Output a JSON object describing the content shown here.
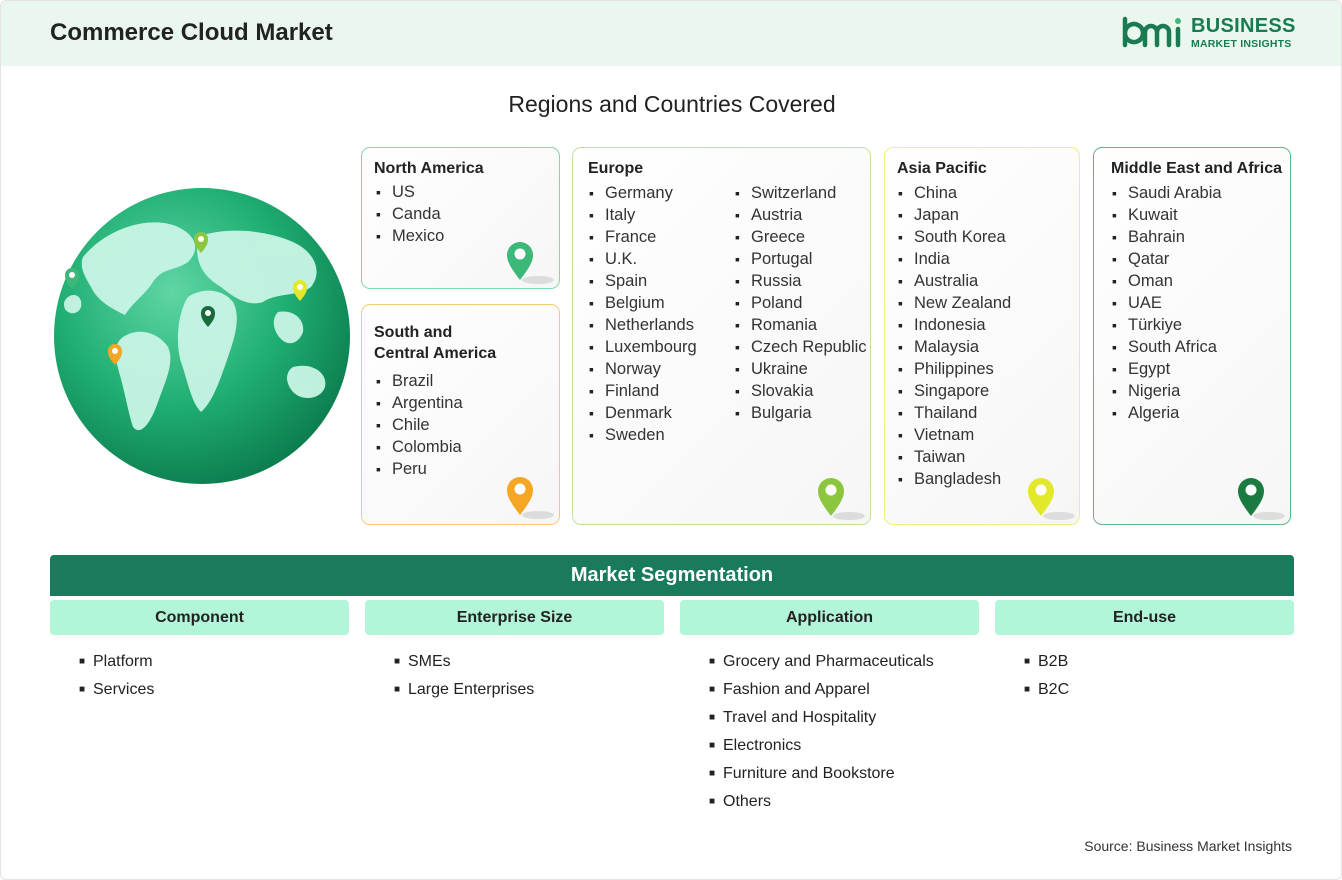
{
  "header": {
    "title": "Commerce Cloud Market"
  },
  "logo": {
    "mark_text": "bmi",
    "line1": "BUSINESS",
    "line2": "MARKET INSIGHTS"
  },
  "regions_title": "Regions and Countries Covered",
  "regions": {
    "north_america": {
      "title": "North America",
      "countries": [
        "US",
        "Canda",
        "Mexico"
      ],
      "color": "#3cb878"
    },
    "south_america": {
      "title_line1": "South and",
      "title_line2": "Central America",
      "countries": [
        "Brazil",
        "Argentina",
        "Chile",
        "Colombia",
        "Peru"
      ],
      "color": "#f5a623"
    },
    "europe": {
      "title": "Europe",
      "countries_col1": [
        "Germany",
        "Italy",
        "France",
        "U.K.",
        "Spain",
        "Belgium",
        "Netherlands",
        "Luxembourg",
        "Norway",
        "Finland",
        "Denmark",
        "Sweden"
      ],
      "countries_col2": [
        "Switzerland",
        "Austria",
        "Greece",
        "Portugal",
        "Russia",
        "Poland",
        "Romania",
        "Czech Republic",
        "Ukraine",
        "Slovakia",
        "Bulgaria"
      ],
      "color": "#8cc63f"
    },
    "asia_pacific": {
      "title": "Asia Pacific",
      "countries": [
        "China",
        "Japan",
        "South Korea",
        "India",
        "Australia",
        "New Zealand",
        "Indonesia",
        "Malaysia",
        "Philippines",
        "Singapore",
        "Thailand",
        "Vietnam",
        "Taiwan",
        "Bangladesh"
      ],
      "color": "#e3e82a"
    },
    "mea": {
      "title": "Middle East and Africa",
      "countries": [
        "Saudi Arabia",
        "Kuwait",
        "Bahrain",
        "Qatar",
        "Oman",
        "UAE",
        "Türkiye",
        "South Africa",
        "Egypt",
        "Nigeria",
        "Algeria"
      ],
      "color": "#1a7a40"
    }
  },
  "segmentation": {
    "title": "Market Segmentation",
    "columns": [
      {
        "head": "Component",
        "items": [
          "Platform",
          "Services"
        ]
      },
      {
        "head": "Enterprise Size",
        "items": [
          "SMEs",
          "Large Enterprises"
        ]
      },
      {
        "head": "Application",
        "items": [
          "Grocery and Pharmaceuticals",
          "Fashion and Apparel",
          "Travel and Hospitality",
          "Electronics",
          "Furniture and Bookstore",
          "Others"
        ]
      },
      {
        "head": "End-use",
        "items": [
          "B2B",
          "B2C"
        ]
      }
    ]
  },
  "source": "Source: Business Market Insights"
}
